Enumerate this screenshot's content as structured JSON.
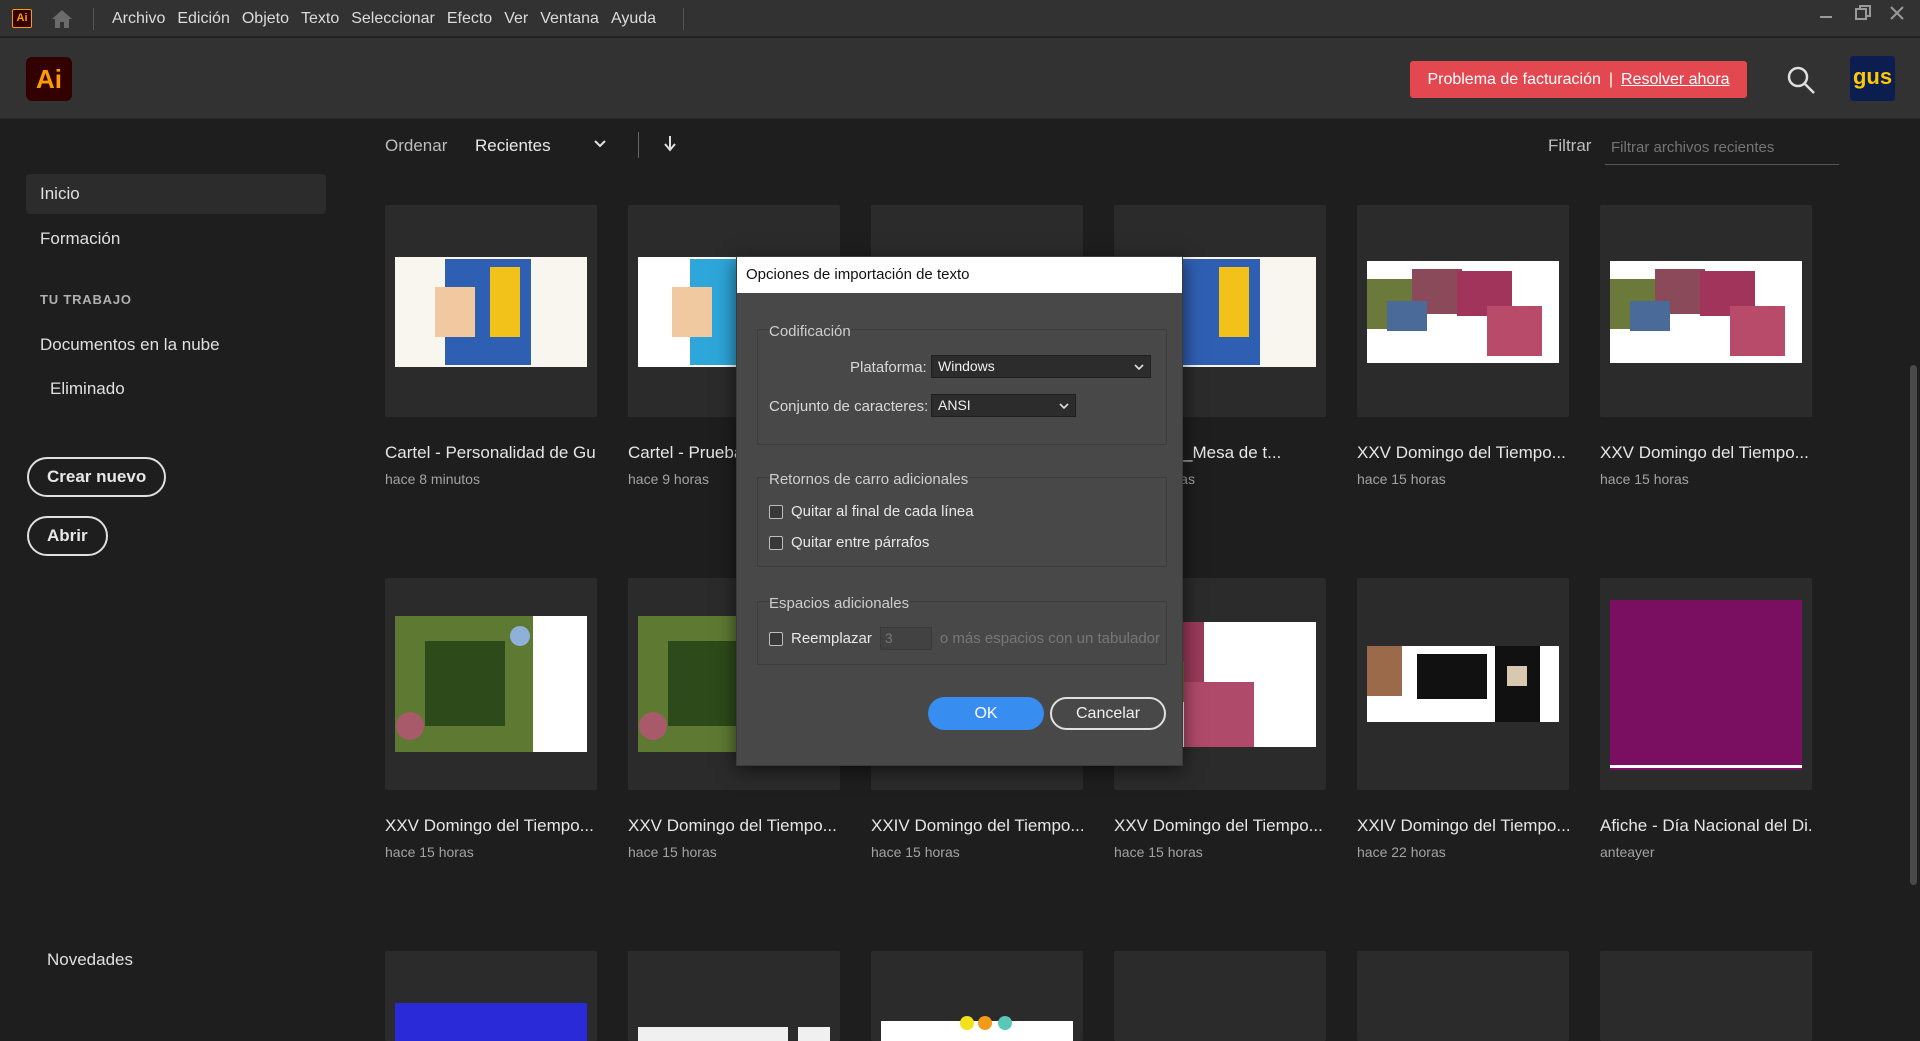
{
  "menubar": {
    "app_icon": "Ai",
    "items": [
      "Archivo",
      "Edición",
      "Objeto",
      "Texto",
      "Seleccionar",
      "Efecto",
      "Ver",
      "Ventana",
      "Ayuda"
    ]
  },
  "header": {
    "logo": "Ai",
    "billing_text": "Problema de facturación",
    "billing_link": "Resolver ahora",
    "avatar": "gus"
  },
  "sidebar": {
    "items": [
      "Inicio",
      "Formación"
    ],
    "section_title": "TU TRABAJO",
    "work_items": [
      "Documentos en la nube",
      "Eliminado"
    ],
    "create_button": "Crear nuevo",
    "open_button": "Abrir",
    "news": "Novedades"
  },
  "toolbar": {
    "sort_label": "Ordenar",
    "sort_value": "Recientes",
    "filter_label": "Filtrar",
    "filter_placeholder": "Filtrar archivos recientes"
  },
  "files": [
    {
      "name": "Cartel - Personalidad de Gu...",
      "time": "hace 8 minutos",
      "thumb": "poster"
    },
    {
      "name": "Cartel - Prueba",
      "time": "hace 9 horas",
      "thumb": "poster"
    },
    {
      "name": "",
      "time": "",
      "thumb": "blank"
    },
    {
      "name": "Prueba 1_Mesa de t...",
      "time": "hace 9 horas",
      "thumb": "poster"
    },
    {
      "name": "XXV Domingo del Tiempo...",
      "time": "hace 15 horas",
      "thumb": "grapes"
    },
    {
      "name": "XXV Domingo del Tiempo...",
      "time": "hace 15 horas",
      "thumb": "grapes"
    },
    {
      "name": "XXV Domingo del Tiempo...",
      "time": "hace 15 horas",
      "thumb": "leaves"
    },
    {
      "name": "XXV Domingo del Tiempo...",
      "time": "hace 15 horas",
      "thumb": "leaves"
    },
    {
      "name": "XXIV Domingo del Tiempo...",
      "time": "hace 15 horas",
      "thumb": "blank"
    },
    {
      "name": "XXV Domingo del Tiempo...",
      "time": "hace 15 horas",
      "thumb": "grapes2"
    },
    {
      "name": "XXIV Domingo del Tiempo...",
      "time": "hace 22 horas",
      "thumb": "hands"
    },
    {
      "name": "Afiche - Día Nacional del Di...",
      "time": "anteayer",
      "thumb": "purple"
    }
  ],
  "dialog": {
    "title": "Opciones de importación de texto",
    "encoding_group": "Codificación",
    "platform_label": "Plataforma:",
    "platform_value": "Windows",
    "charset_label": "Conjunto de caracteres:",
    "charset_value": "ANSI",
    "returns_group": "Retornos de carro adicionales",
    "remove_line_end": "Quitar al final de cada línea",
    "remove_between": "Quitar entre párrafos",
    "spaces_group": "Espacios adicionales",
    "replace_label": "Reemplazar",
    "replace_value": "3",
    "replace_suffix": "o más espacios con un tabulador",
    "ok": "OK",
    "cancel": "Cancelar"
  },
  "colors": {
    "accent": "#378ef0",
    "billing": "#e34850",
    "ai_orange": "#ff9a00"
  }
}
